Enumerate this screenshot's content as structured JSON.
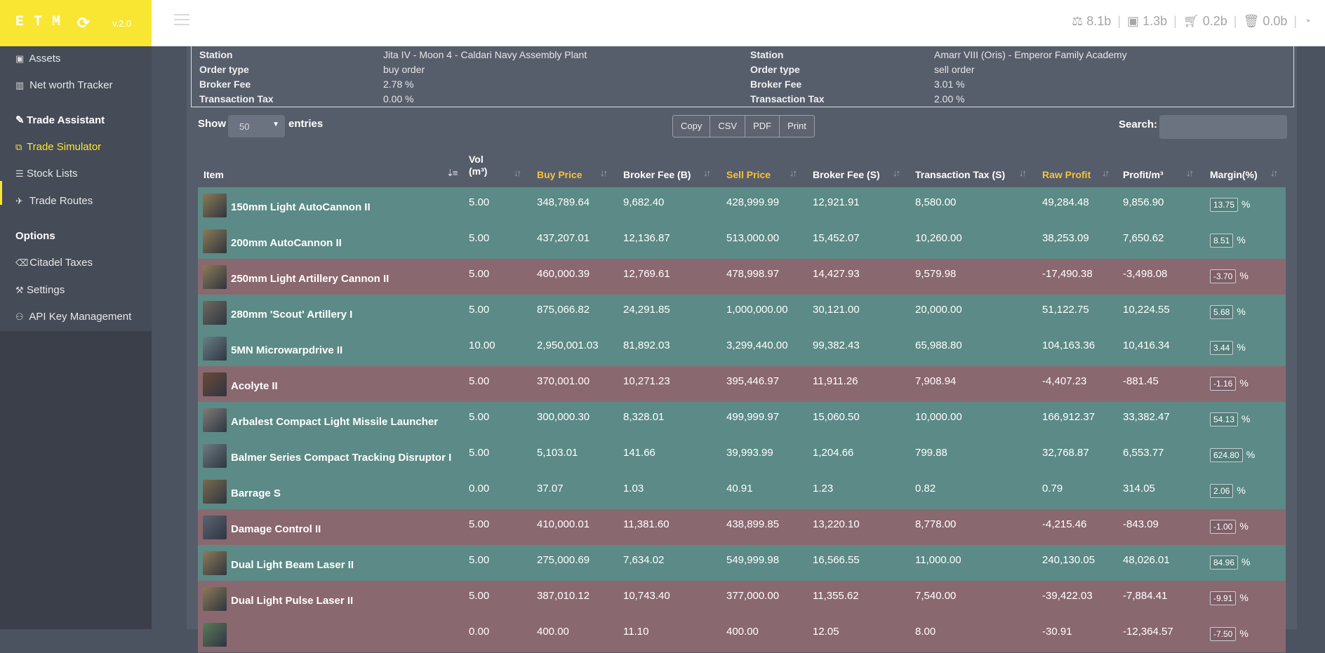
{
  "brand": {
    "title": "ETM",
    "version": "v.2.0"
  },
  "header_stats": [
    {
      "icon": "scale-icon",
      "value": "8.1b"
    },
    {
      "icon": "briefcase-icon",
      "value": "1.3b"
    },
    {
      "icon": "cart-icon",
      "value": "0.2b"
    },
    {
      "icon": "trash-icon",
      "value": "0.0b"
    }
  ],
  "sidebar": {
    "items": [
      {
        "label": "Assets",
        "icon": "briefcase-icon"
      },
      {
        "label": "Net worth Tracker",
        "icon": "bar-chart-icon"
      },
      {
        "label": "Trade Assistant",
        "icon": "magic-wand-icon"
      },
      {
        "label": "Trade Simulator",
        "icon": "copy-icon"
      },
      {
        "label": "Stock Lists",
        "icon": "list-icon"
      },
      {
        "label": "Trade Routes",
        "icon": "plane-icon"
      },
      {
        "label": "Options",
        "icon": ""
      },
      {
        "label": "Citadel Taxes",
        "icon": "eraser-icon"
      },
      {
        "label": "Settings",
        "icon": "wrench-icon"
      },
      {
        "label": "API Key Management",
        "icon": "users-icon"
      }
    ]
  },
  "station_info": {
    "left": {
      "labels": [
        "Station",
        "Order type",
        "Broker Fee",
        "Transaction Tax"
      ],
      "values": [
        "Jita IV - Moon 4 - Caldari Navy Assembly Plant",
        "buy order",
        "2.78 %",
        "0.00 %"
      ]
    },
    "right": {
      "labels": [
        "Station",
        "Order type",
        "Broker Fee",
        "Transaction Tax"
      ],
      "values": [
        "Amarr VIII (Oris) - Emperor Family Academy",
        "sell order",
        "3.01 %",
        "2.00 %"
      ]
    }
  },
  "controls": {
    "show": "Show",
    "entries_value": "50",
    "entries_label": "entries",
    "buttons": [
      "Copy",
      "CSV",
      "PDF",
      "Print"
    ],
    "search_label": "Search:"
  },
  "table": {
    "headers": [
      "Item",
      "Vol",
      "(m³)",
      "Buy Price",
      "Broker Fee (B)",
      "Sell Price",
      "Broker Fee (S)",
      "Transaction Tax (S)",
      "Raw Profit",
      "Profit/m³",
      "Margin(%)"
    ],
    "margin_unit": "%",
    "rows": [
      {
        "item": "150mm Light AutoCannon II",
        "vol": "5.00",
        "buy": "348,789.64",
        "bfb": "9,682.40",
        "sell": "428,999.99",
        "bfs": "12,921.91",
        "tax": "8,580.00",
        "raw": "49,284.48",
        "ppm": "9,856.90",
        "margin": "13.75",
        "status": "pos"
      },
      {
        "item": "200mm AutoCannon II",
        "vol": "5.00",
        "buy": "437,207.01",
        "bfb": "12,136.87",
        "sell": "513,000.00",
        "bfs": "15,452.07",
        "tax": "10,260.00",
        "raw": "38,253.09",
        "ppm": "7,650.62",
        "margin": "8.51",
        "status": "pos"
      },
      {
        "item": "250mm Light Artillery Cannon II",
        "vol": "5.00",
        "buy": "460,000.39",
        "bfb": "12,769.61",
        "sell": "478,998.97",
        "bfs": "14,427.93",
        "tax": "9,579.98",
        "raw": "-17,490.38",
        "ppm": "-3,498.08",
        "margin": "-3.70",
        "status": "neg"
      },
      {
        "item": "280mm 'Scout' Artillery I",
        "vol": "5.00",
        "buy": "875,066.82",
        "bfb": "24,291.85",
        "sell": "1,000,000.00",
        "bfs": "30,121.00",
        "tax": "20,000.00",
        "raw": "51,122.75",
        "ppm": "10,224.55",
        "margin": "5.68",
        "status": "pos"
      },
      {
        "item": "5MN Microwarpdrive II",
        "vol": "10.00",
        "buy": "2,950,001.03",
        "bfb": "81,892.03",
        "sell": "3,299,440.00",
        "bfs": "99,382.43",
        "tax": "65,988.80",
        "raw": "104,163.36",
        "ppm": "10,416.34",
        "margin": "3.44",
        "status": "pos"
      },
      {
        "item": "Acolyte II",
        "vol": "5.00",
        "buy": "370,001.00",
        "bfb": "10,271.23",
        "sell": "395,446.97",
        "bfs": "11,911.26",
        "tax": "7,908.94",
        "raw": "-4,407.23",
        "ppm": "-881.45",
        "margin": "-1.16",
        "status": "neg"
      },
      {
        "item": "Arbalest Compact Light Missile Launcher",
        "vol": "5.00",
        "buy": "300,000.30",
        "bfb": "8,328.01",
        "sell": "499,999.97",
        "bfs": "15,060.50",
        "tax": "10,000.00",
        "raw": "166,912.37",
        "ppm": "33,382.47",
        "margin": "54.13",
        "status": "pos"
      },
      {
        "item": "Balmer Series Compact Tracking Disruptor I",
        "vol": "5.00",
        "buy": "5,103.01",
        "bfb": "141.66",
        "sell": "39,993.99",
        "bfs": "1,204.66",
        "tax": "799.88",
        "raw": "32,768.87",
        "ppm": "6,553.77",
        "margin": "624.80",
        "status": "pos"
      },
      {
        "item": "Barrage S",
        "vol": "0.00",
        "buy": "37.07",
        "bfb": "1.03",
        "sell": "40.91",
        "bfs": "1.23",
        "tax": "0.82",
        "raw": "0.79",
        "ppm": "314.05",
        "margin": "2.06",
        "status": "pos"
      },
      {
        "item": "Damage Control II",
        "vol": "5.00",
        "buy": "410,000.01",
        "bfb": "11,381.60",
        "sell": "438,899.85",
        "bfs": "13,220.10",
        "tax": "8,778.00",
        "raw": "-4,215.46",
        "ppm": "-843.09",
        "margin": "-1.00",
        "status": "neg"
      },
      {
        "item": "Dual Light Beam Laser II",
        "vol": "5.00",
        "buy": "275,000.69",
        "bfb": "7,634.02",
        "sell": "549,999.98",
        "bfs": "16,566.55",
        "tax": "11,000.00",
        "raw": "240,130.05",
        "ppm": "48,026.01",
        "margin": "84.96",
        "status": "pos"
      },
      {
        "item": "Dual Light Pulse Laser II",
        "vol": "5.00",
        "buy": "387,010.12",
        "bfb": "10,743.40",
        "sell": "377,000.00",
        "bfs": "11,355.62",
        "tax": "7,540.00",
        "raw": "-39,422.03",
        "ppm": "-7,884.41",
        "margin": "-9.91",
        "status": "neg"
      },
      {
        "item": "",
        "vol": "0.00",
        "buy": "400.00",
        "bfb": "11.10",
        "sell": "400.00",
        "bfs": "12.05",
        "tax": "8.00",
        "raw": "-30.91",
        "ppm": "-12,364.57",
        "margin": "-7.50",
        "status": "neg"
      }
    ]
  }
}
